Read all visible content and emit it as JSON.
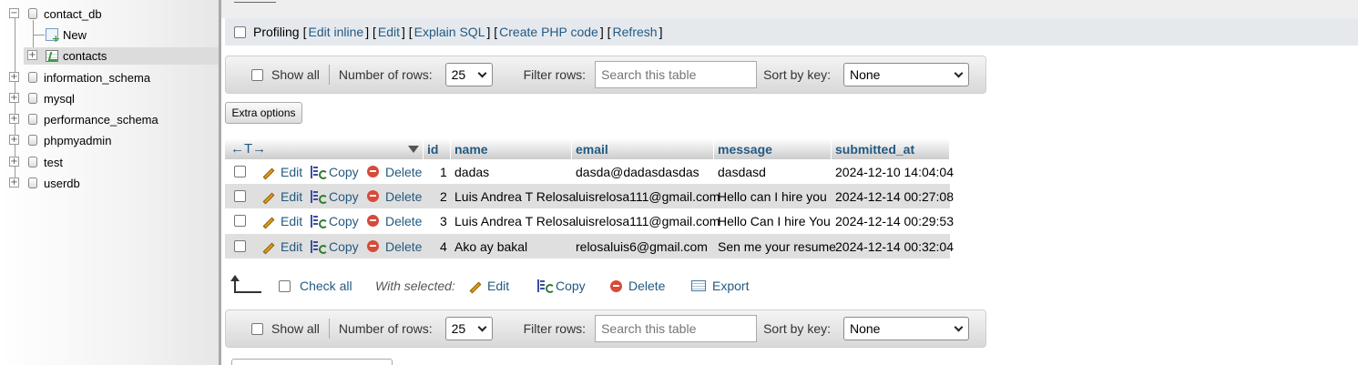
{
  "sidebar": {
    "databases": [
      {
        "name": "contact_db",
        "expanded": true
      },
      {
        "name": "information_schema"
      },
      {
        "name": "mysql"
      },
      {
        "name": "performance_schema"
      },
      {
        "name": "phpmyadmin"
      },
      {
        "name": "test"
      },
      {
        "name": "userdb"
      }
    ],
    "contact_db_children": [
      {
        "name": "New"
      },
      {
        "name": "contacts"
      }
    ],
    "expander_collapsed": "+",
    "expander_expanded": "−"
  },
  "profiling": {
    "label": "Profiling",
    "links": [
      "Edit inline",
      "Edit",
      "Explain SQL",
      "Create PHP code",
      "Refresh"
    ]
  },
  "nav": {
    "show_all": "Show all",
    "num_rows_label": "Number of rows:",
    "num_rows_value": "25",
    "filter_label": "Filter rows:",
    "filter_placeholder": "Search this table",
    "sort_label": "Sort by key:",
    "sort_value": "None"
  },
  "extra_options": "Extra options",
  "table": {
    "nav_arrows": "←T→",
    "columns": [
      "id",
      "name",
      "email",
      "message",
      "submitted_at"
    ],
    "actions": {
      "edit": "Edit",
      "copy": "Copy",
      "delete": "Delete"
    },
    "rows": [
      {
        "id": "1",
        "name": "dadas",
        "email": "dasda@dadasdasdas",
        "message": "dasdasd",
        "submitted_at": "2024-12-10 14:04:04"
      },
      {
        "id": "2",
        "name": "Luis Andrea T Relosa",
        "email": "luisrelosa111@gmail.com",
        "message": "Hello can I hire you",
        "submitted_at": "2024-12-14 00:27:08"
      },
      {
        "id": "3",
        "name": "Luis Andrea T Relosa",
        "email": "luisrelosa111@gmail.com",
        "message": "Hello Can I hire You",
        "submitted_at": "2024-12-14 00:29:53"
      },
      {
        "id": "4",
        "name": "Ako ay bakal",
        "email": "relosaluis6@gmail.com",
        "message": "Sen me your resume",
        "submitted_at": "2024-12-14 00:32:04"
      }
    ]
  },
  "with_selected": {
    "check_all": "Check all",
    "label": "With selected:",
    "edit": "Edit",
    "copy": "Copy",
    "delete": "Delete",
    "export": "Export"
  },
  "colors": {
    "link": "#235a81",
    "row_alt": "#dfdfdf",
    "delete_icon": "#d64b3a"
  }
}
